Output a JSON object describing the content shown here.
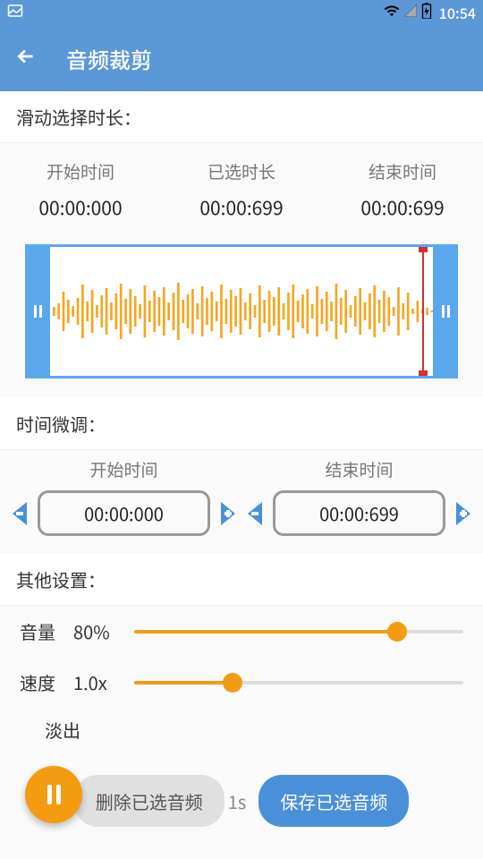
{
  "status": {
    "time": "10:54"
  },
  "header": {
    "title": "音频裁剪"
  },
  "slide_section": {
    "title": "滑动选择时长：",
    "start_label": "开始时间",
    "duration_label": "已选时长",
    "end_label": "结束时间",
    "start_value": "00:00:000",
    "duration_value": "00:00:699",
    "end_value": "00:00:699"
  },
  "fine_tune": {
    "title": "时间微调：",
    "start_label": "开始时间",
    "end_label": "结束时间",
    "start_value": "00:00:000",
    "end_value": "00:00:699"
  },
  "other_settings": {
    "title": "其他设置：",
    "volume_label": "音量",
    "volume_value": "80%",
    "volume_percent": 80,
    "speed_label": "速度",
    "speed_value": "1.0x",
    "speed_percent": 30,
    "fade_label": "淡出"
  },
  "buttons": {
    "delete": "删除已选音频",
    "mid": "1s",
    "save": "保存已选音频"
  }
}
